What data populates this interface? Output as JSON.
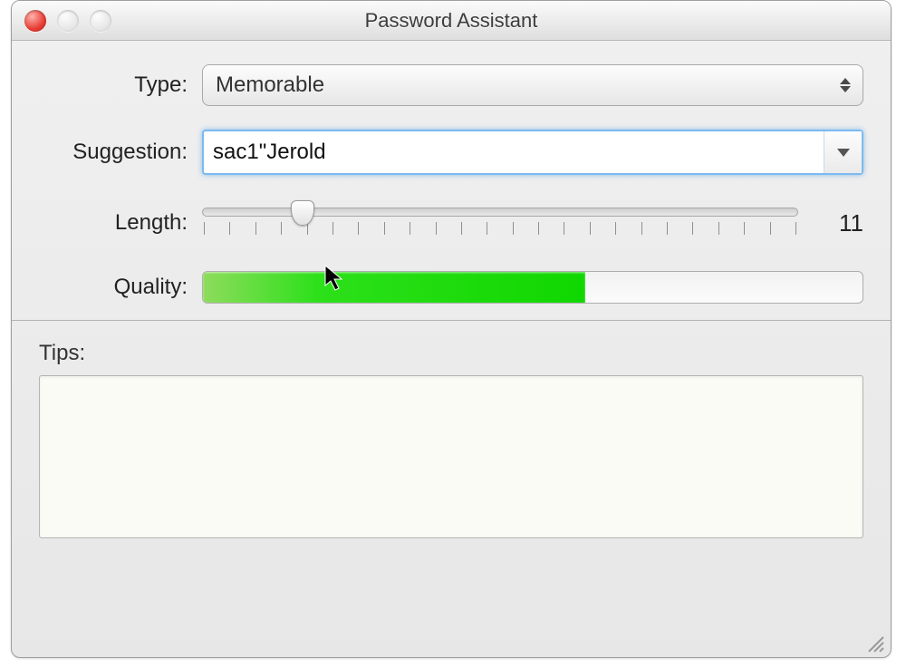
{
  "window": {
    "title": "Password Assistant"
  },
  "labels": {
    "type": "Type:",
    "suggestion": "Suggestion:",
    "length": "Length:",
    "quality": "Quality:",
    "tips": "Tips:"
  },
  "type": {
    "selected": "Memorable"
  },
  "suggestion": {
    "value": "sac1\"Jerold"
  },
  "length": {
    "value": "11",
    "slider_percent": 16.8,
    "min": 8,
    "max": 31,
    "ticks": 24
  },
  "quality": {
    "percent": 58,
    "color": "#1ed60a"
  },
  "tips": {
    "text": ""
  }
}
